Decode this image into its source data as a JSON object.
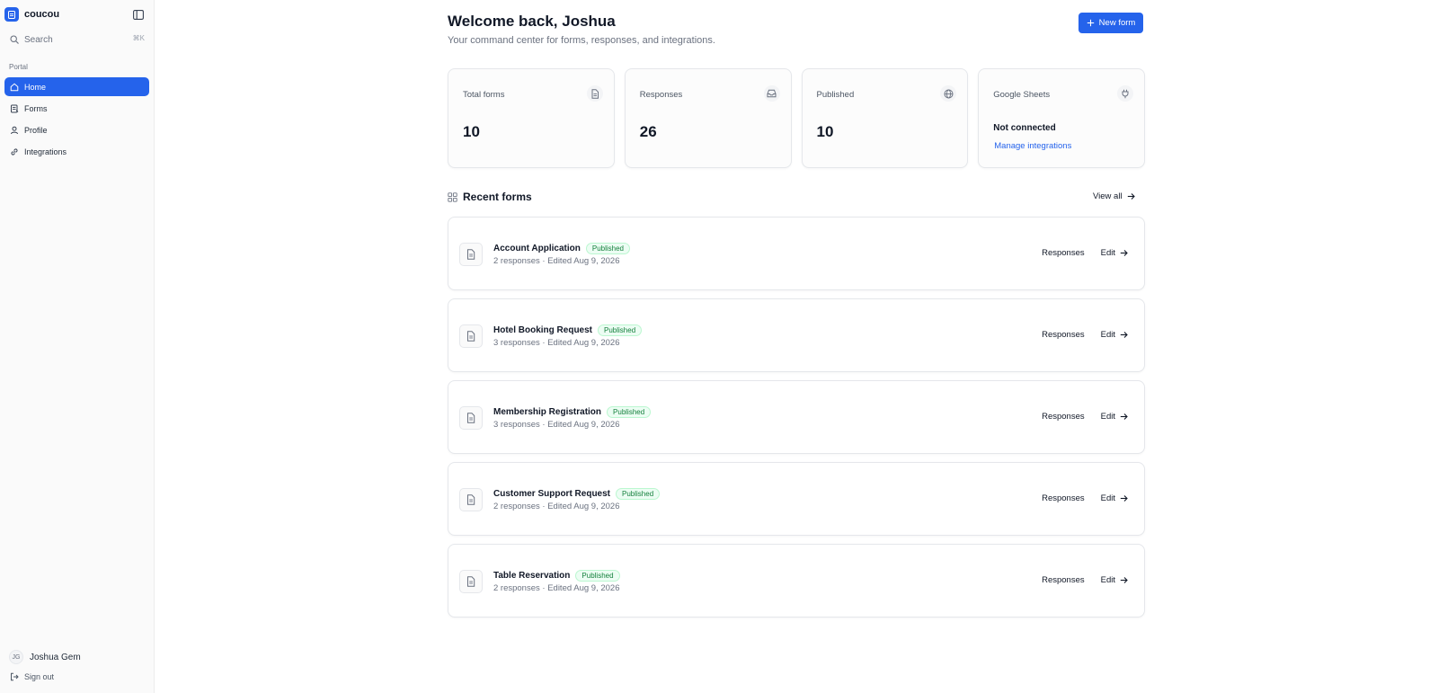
{
  "app": {
    "name": "coucou"
  },
  "sidebar": {
    "search_label": "Search",
    "search_shortcut": "⌘K",
    "section_label": "Portal",
    "items": [
      {
        "label": "Home",
        "icon": "home-icon",
        "active": true
      },
      {
        "label": "Forms",
        "icon": "forms-icon",
        "active": false
      },
      {
        "label": "Profile",
        "icon": "user-icon",
        "active": false
      },
      {
        "label": "Integrations",
        "icon": "link-icon",
        "active": false
      }
    ],
    "user": {
      "initials": "JG",
      "name": "Joshua Gem"
    },
    "signout_label": "Sign out"
  },
  "header": {
    "title": "Welcome back, Joshua",
    "subtitle": "Your command center for forms, responses, and integrations.",
    "new_form_label": "New form"
  },
  "stats": [
    {
      "label": "Total forms",
      "value": "10",
      "icon": "document-icon"
    },
    {
      "label": "Responses",
      "value": "26",
      "icon": "inbox-icon"
    },
    {
      "label": "Published",
      "value": "10",
      "icon": "globe-icon"
    },
    {
      "label": "Google Sheets",
      "status": "Not connected",
      "link": "Manage integrations",
      "icon": "plug-icon"
    }
  ],
  "recent": {
    "title": "Recent forms",
    "view_all_label": "View all",
    "responses_label": "Responses",
    "edit_label": "Edit",
    "forms": [
      {
        "name": "Account Application",
        "badge": "Published",
        "meta": "2 responses · Edited Aug 9, 2026"
      },
      {
        "name": "Hotel Booking Request",
        "badge": "Published",
        "meta": "3 responses · Edited Aug 9, 2026"
      },
      {
        "name": "Membership Registration",
        "badge": "Published",
        "meta": "3 responses · Edited Aug 9, 2026"
      },
      {
        "name": "Customer Support Request",
        "badge": "Published",
        "meta": "2 responses · Edited Aug 9, 2026"
      },
      {
        "name": "Table Reservation",
        "badge": "Published",
        "meta": "2 responses · Edited Aug 9, 2026"
      }
    ]
  },
  "colors": {
    "accent": "#2563eb",
    "published_text": "#15803d",
    "published_bg": "#ecfdf3"
  }
}
